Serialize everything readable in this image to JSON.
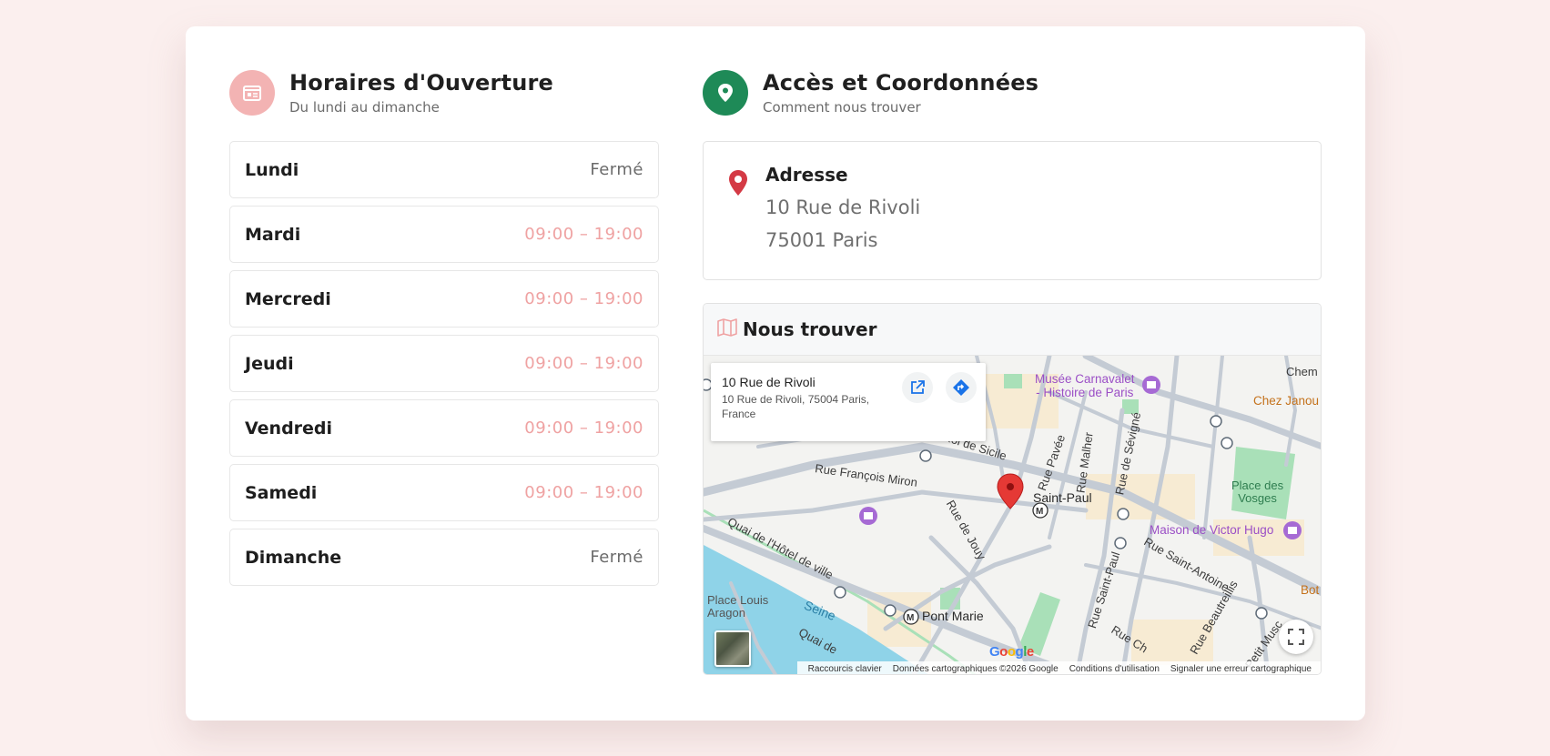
{
  "hours": {
    "title": "Horaires d'Ouverture",
    "subtitle": "Du lundi au dimanche",
    "days": [
      {
        "name": "Lundi",
        "hours": "Fermé"
      },
      {
        "name": "Mardi",
        "hours": "09:00 – 19:00"
      },
      {
        "name": "Mercredi",
        "hours": "09:00 – 19:00"
      },
      {
        "name": "Jeudi",
        "hours": "09:00 – 19:00"
      },
      {
        "name": "Vendredi",
        "hours": "09:00 – 19:00"
      },
      {
        "name": "Samedi",
        "hours": "09:00 – 19:00"
      },
      {
        "name": "Dimanche",
        "hours": "Fermé"
      }
    ]
  },
  "access": {
    "title": "Accès et Coordonnées",
    "subtitle": "Comment nous trouver",
    "address_title": "Adresse",
    "address_line1": "10 Rue de Rivoli",
    "address_line2": "75001 Paris"
  },
  "map": {
    "title": "Nous trouver",
    "info_title": "10 Rue de Rivoli",
    "info_address": "10 Rue de Rivoli, 75004 Paris, France",
    "labels": {
      "musee": "Musée Carnavalet\n- Histoire de Paris",
      "chez": "Chez Janou",
      "chem": "Chem",
      "roi_sicile": "Roi de Sicile",
      "francois_miron": "Rue François Miron",
      "pavee": "Rue Pavée",
      "malher": "Rue Malher",
      "sevigne": "Rue de Sévigné",
      "vosges": "Place des\nVosges",
      "saint_paul": "Saint-Paul",
      "victor_hugo": "Maison de Victor Hugo",
      "jouy": "Rue de Jouy",
      "quai_ville": "Quai de l'Hôtel de ville",
      "louis_aragon": "Place Louis\nAragon",
      "seine": "Seine",
      "pont_marie": "Pont Marie",
      "rue_saint_paul": "Rue Saint-Paul",
      "saint_antoine": "Rue Saint-Antoine",
      "beautreillis": "Rue Beautreillis",
      "petit_musc": "Petit Musc",
      "bot": "Bot",
      "quai_small": "Quai de",
      "rue_ch": "Rue Ch"
    },
    "footer": {
      "shortcuts": "Raccourcis clavier",
      "data": "Données cartographiques ©2026 Google",
      "terms": "Conditions d'utilisation",
      "report": "Signaler une erreur cartographique"
    },
    "google": "Google",
    "colors": {
      "water": "#8fd3e8",
      "park": "#a9e0b8",
      "road": "#c4cbd4",
      "pin": "#e53935"
    }
  },
  "colors": {
    "accent_pink": "#efa2a2",
    "accent_green": "#1e8a57",
    "background": "#fbefee"
  }
}
